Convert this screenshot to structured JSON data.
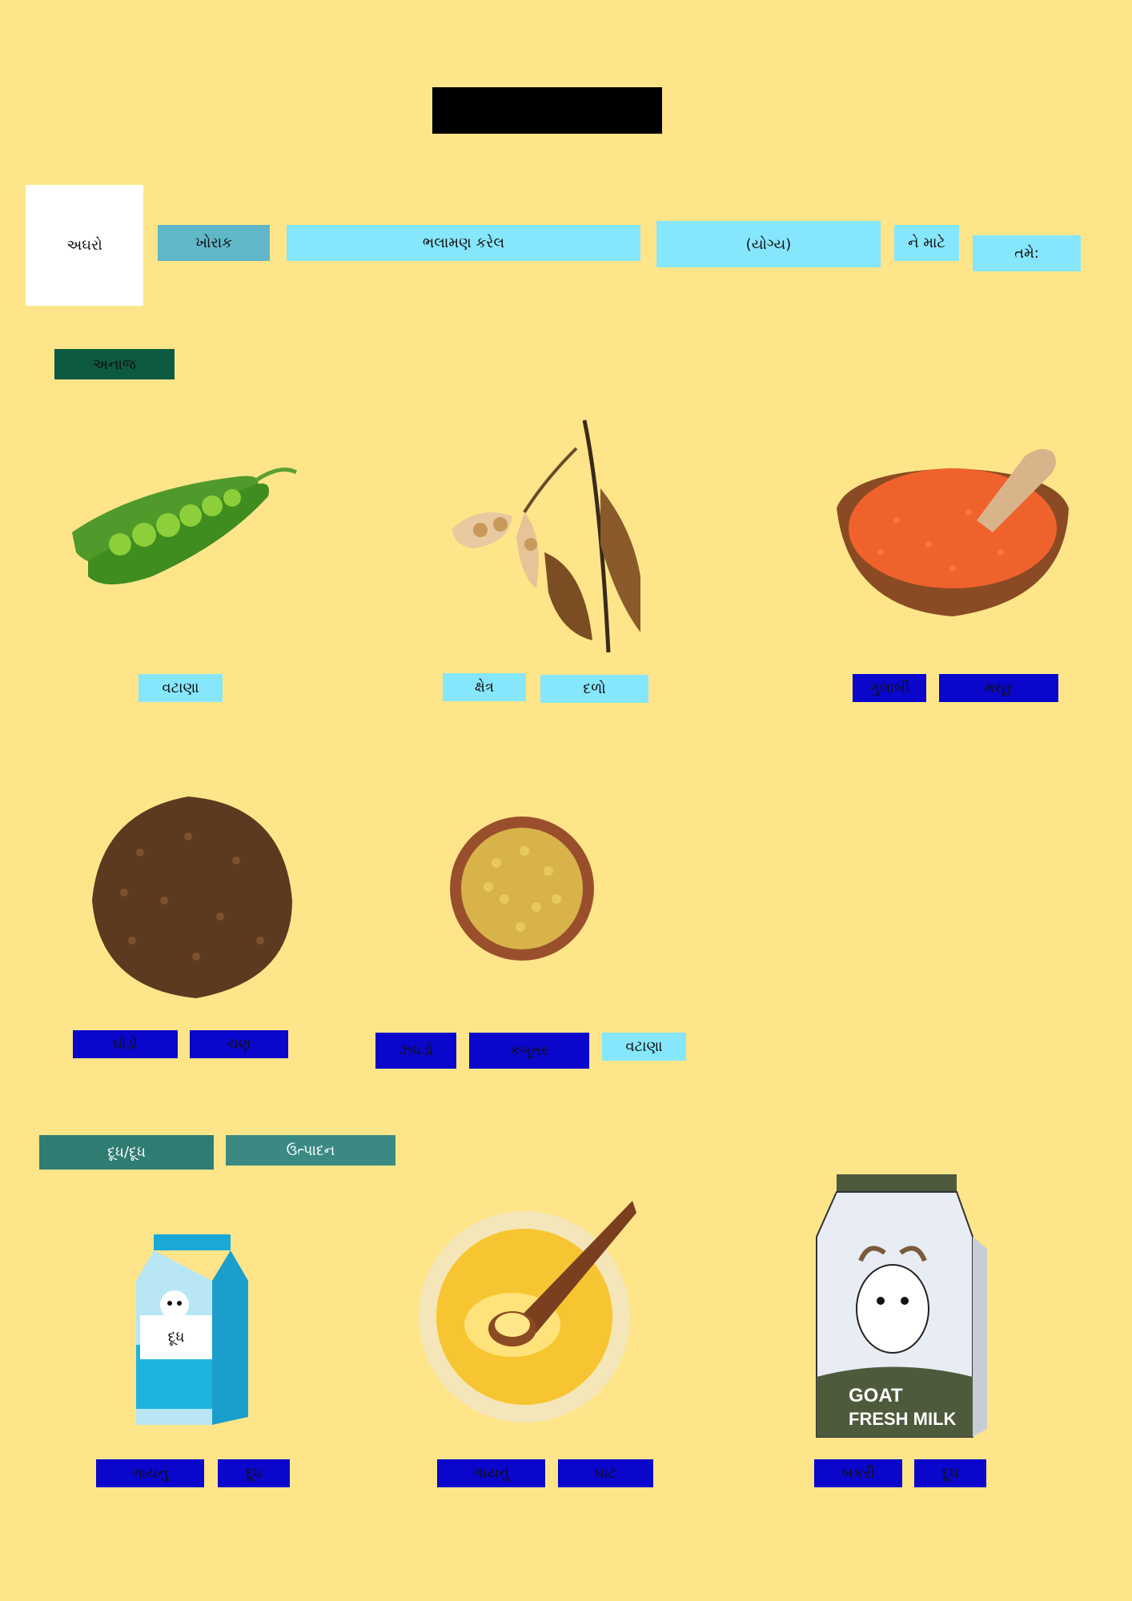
{
  "header": {
    "redacted_title": ""
  },
  "title_row": {
    "first_word": "અઘરો",
    "words": [
      "ખોરાક",
      "ભલામણ કરેલ",
      "(યોગ્ય)",
      "ને માટે",
      "તમે:"
    ]
  },
  "sections": {
    "grains": {
      "label": "અનાજ",
      "items": [
        {
          "image": "green-peas",
          "words": [
            "વટાણા"
          ]
        },
        {
          "image": "soybean-pods",
          "words": [
            "ક્ષેત્ર",
            "દળો"
          ]
        },
        {
          "image": "red-lentils-bowl",
          "words": [
            "ગુલાબી",
            "મસૂર"
          ]
        },
        {
          "image": "buckwheat-pile",
          "words": [
            "ઘોડો",
            "ચણ"
          ]
        },
        {
          "image": "split-pigeon-peas-bowl",
          "words": [
            "ઝઘડો",
            "કબૂતર",
            "વટાણા"
          ]
        }
      ]
    },
    "dairy": {
      "labels": [
        "દૂધ/દૂધ",
        "ઉત્પાદન"
      ],
      "items": [
        {
          "image": "milk-carton",
          "carton_label": "દૂધ",
          "words": [
            "ગાયનું",
            "દૂધ"
          ]
        },
        {
          "image": "ghee-jar",
          "words": [
            "ગાયનું",
            "ઘાટ"
          ]
        },
        {
          "image": "goat-milk-pack",
          "pack_text": [
            "GOAT",
            "FRESH MILK"
          ],
          "words": [
            "બકરી",
            "દૂધ"
          ]
        }
      ]
    }
  },
  "colors": {
    "background": "#ffe58a",
    "cyan_tile": "#86e6fb",
    "teal_tile": "#5fb7c7",
    "blue_tile": "#0a06cc",
    "section_green": "#0d5a43",
    "section_teal": "#2f7c73"
  }
}
